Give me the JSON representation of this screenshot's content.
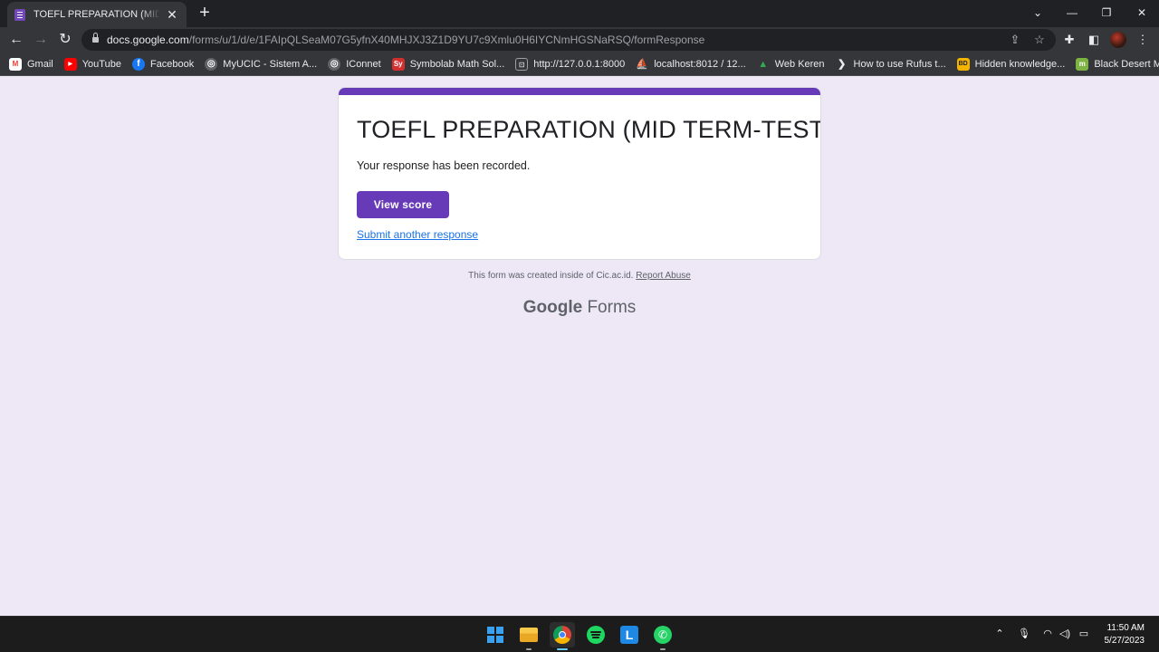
{
  "browser": {
    "tab": {
      "title": "TOEFL PREPARATION (MID TERM-TEST)",
      "favicon": "google-forms-icon"
    },
    "address": {
      "host": "docs.google.com",
      "path": "/forms/u/1/d/e/1FAIpQLSeaM07G5yfnX40MHJXJ3Z1D9YU7c9Xmlu0H6IYCNmHGSNaRSQ/formResponse"
    },
    "bookmarks": [
      {
        "label": "Gmail",
        "icon": "gmail-icon",
        "color": "#ea4335",
        "glyph": "M"
      },
      {
        "label": "YouTube",
        "icon": "youtube-icon",
        "color": "#ff0000",
        "glyph": "▶"
      },
      {
        "label": "Facebook",
        "icon": "facebook-icon",
        "color": "#1877f2",
        "glyph": "f"
      },
      {
        "label": "MyUCIC - Sistem A...",
        "icon": "globe-icon",
        "color": "#5f6368",
        "glyph": "◎"
      },
      {
        "label": "IConnet",
        "icon": "globe-icon",
        "color": "#5f6368",
        "glyph": "◎"
      },
      {
        "label": "Symbolab Math Sol...",
        "icon": "symbolab-icon",
        "color": "#d32f2f",
        "glyph": "Sy"
      },
      {
        "label": "http://127.0.0.1:8000",
        "icon": "page-icon",
        "color": "#5f6368",
        "glyph": "⊡"
      },
      {
        "label": "localhost:8012 / 12...",
        "icon": "phpmyadmin-icon",
        "color": "#f39c12",
        "glyph": "⛵"
      },
      {
        "label": "Web Keren",
        "icon": "google-drive-icon",
        "color": "#34a853",
        "glyph": "▲"
      },
      {
        "label": "How to use Rufus t...",
        "icon": "rufus-icon",
        "color": "#202124",
        "glyph": "❯"
      },
      {
        "label": "Hidden knowledge...",
        "icon": "bd-icon",
        "color": "#f4b400",
        "glyph": "BD"
      },
      {
        "label": "Black Desert Mobil...",
        "icon": "bdm-icon",
        "color": "#7cb342",
        "glyph": "m"
      }
    ]
  },
  "form": {
    "title": "TOEFL PREPARATION (MID TERM-TEST)",
    "confirmation": "Your response has been recorded.",
    "view_score_label": "View score",
    "submit_another_label": "Submit another response",
    "footer_text": "This form was created inside of Cic.ac.id.",
    "report_abuse_label": "Report Abuse",
    "brand_google": "Google",
    "brand_forms": "Forms",
    "accent_color": "#673ab7"
  },
  "taskbar": {
    "time": "11:50 AM",
    "date": "5/27/2023",
    "apps": [
      "windows-start-icon",
      "file-explorer-icon",
      "chrome-icon",
      "spotify-icon",
      "l-app-icon",
      "whatsapp-icon"
    ]
  }
}
